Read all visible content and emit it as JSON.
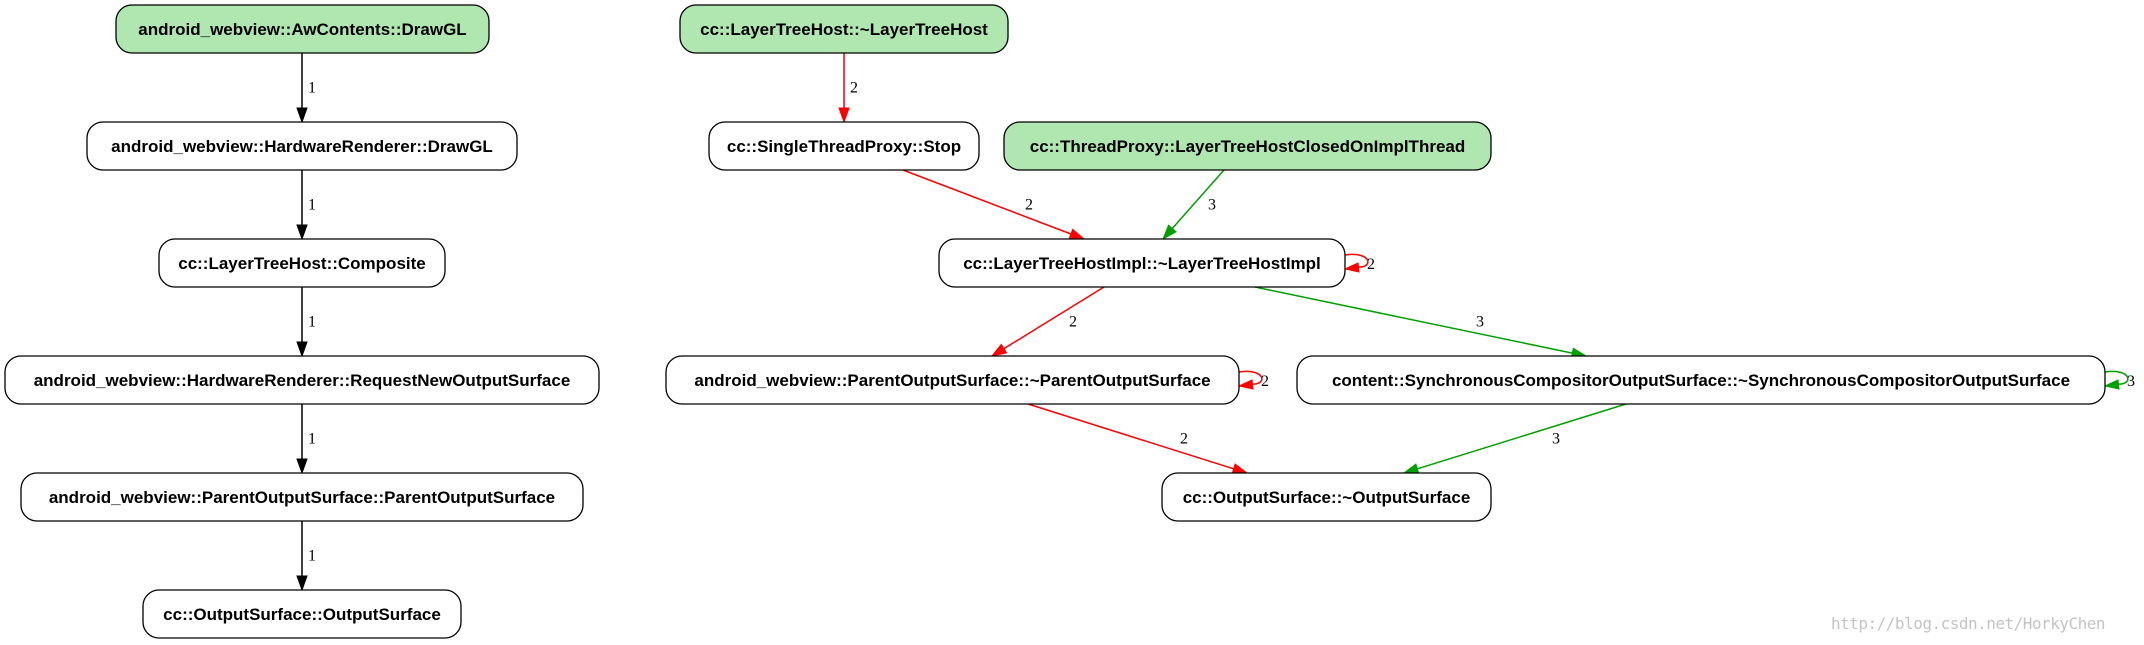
{
  "colors": {
    "root_fill": "#b0e6b0",
    "node_fill": "#ffffff",
    "stroke": "#000000",
    "red_edge": "#ff0000",
    "green_edge": "#00a000",
    "black_edge": "#000000"
  },
  "nodes": [
    {
      "id": "aw_drawgl",
      "label": "android_webview::AwContents::DrawGL",
      "root": true
    },
    {
      "id": "hr_drawgl",
      "label": "android_webview::HardwareRenderer::DrawGL",
      "root": false
    },
    {
      "id": "lth_composite",
      "label": "cc::LayerTreeHost::Composite",
      "root": false
    },
    {
      "id": "hr_request",
      "label": "android_webview::HardwareRenderer::RequestNewOutputSurface",
      "root": false
    },
    {
      "id": "pos_ctor",
      "label": "android_webview::ParentOutputSurface::ParentOutputSurface",
      "root": false
    },
    {
      "id": "os_ctor",
      "label": "cc::OutputSurface::OutputSurface",
      "root": false
    },
    {
      "id": "lth_dtor",
      "label": "cc::LayerTreeHost::~LayerTreeHost",
      "root": true
    },
    {
      "id": "stp_stop",
      "label": "cc::SingleThreadProxy::Stop",
      "root": false
    },
    {
      "id": "tp_closed",
      "label": "cc::ThreadProxy::LayerTreeHostClosedOnImplThread",
      "root": true
    },
    {
      "id": "lthi_dtor",
      "label": "cc::LayerTreeHostImpl::~LayerTreeHostImpl",
      "root": false
    },
    {
      "id": "pos_dtor",
      "label": "android_webview::ParentOutputSurface::~ParentOutputSurface",
      "root": false
    },
    {
      "id": "scos_dtor",
      "label": "content::SynchronousCompositorOutputSurface::~SynchronousCompositorOutputSurface",
      "root": false
    },
    {
      "id": "os_dtor",
      "label": "cc::OutputSurface::~OutputSurface",
      "root": false
    }
  ],
  "edges": [
    {
      "from": "aw_drawgl",
      "to": "hr_drawgl",
      "label": "1",
      "color": "black"
    },
    {
      "from": "hr_drawgl",
      "to": "lth_composite",
      "label": "1",
      "color": "black"
    },
    {
      "from": "lth_composite",
      "to": "hr_request",
      "label": "1",
      "color": "black"
    },
    {
      "from": "hr_request",
      "to": "pos_ctor",
      "label": "1",
      "color": "black"
    },
    {
      "from": "pos_ctor",
      "to": "os_ctor",
      "label": "1",
      "color": "black"
    },
    {
      "from": "lth_dtor",
      "to": "stp_stop",
      "label": "2",
      "color": "red"
    },
    {
      "from": "stp_stop",
      "to": "lthi_dtor",
      "label": "2",
      "color": "red"
    },
    {
      "from": "tp_closed",
      "to": "lthi_dtor",
      "label": "3",
      "color": "green"
    },
    {
      "from": "lthi_dtor",
      "to": "lthi_dtor",
      "label": "2",
      "color": "red"
    },
    {
      "from": "lthi_dtor",
      "to": "pos_dtor",
      "label": "2",
      "color": "red"
    },
    {
      "from": "lthi_dtor",
      "to": "scos_dtor",
      "label": "3",
      "color": "green"
    },
    {
      "from": "pos_dtor",
      "to": "pos_dtor",
      "label": "2",
      "color": "red"
    },
    {
      "from": "scos_dtor",
      "to": "scos_dtor",
      "label": "3",
      "color": "green"
    },
    {
      "from": "pos_dtor",
      "to": "os_dtor",
      "label": "2",
      "color": "red"
    },
    {
      "from": "scos_dtor",
      "to": "os_dtor",
      "label": "3",
      "color": "green"
    }
  ],
  "watermark": "http://blog.csdn.net/HorkyChen"
}
